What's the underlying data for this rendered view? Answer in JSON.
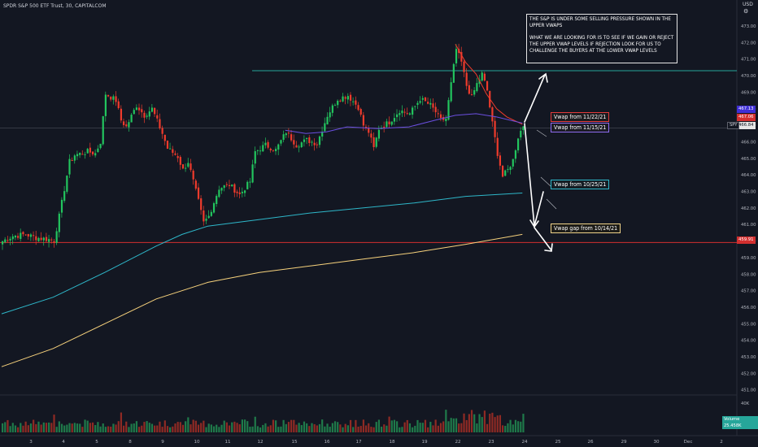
{
  "header": {
    "title": "SPDR S&P 500 ETF Trust, 30, CAPITALCOM",
    "currency": "USD"
  },
  "note": {
    "paragraph1": "THE S&P IS UNDER SOME SELLING PRESSURE SHOWN IN THE UPPER VWAPS",
    "paragraph2": "WHAT WE ARE LOOKING FOR IS TO SEE IF WE GAIN OR REJECT THE UPPER VWAP LEVELS IF REJECTION LOOK FOR US TO CHALLENGE THE BUYERS AT THE LOWER VWAP LEVELS"
  },
  "labels": {
    "vwap_1122": "Vwap from 11/22/21",
    "vwap_1115": "Vwap from 11/15/21",
    "vwap_1025": "Vwap from 10/25/21",
    "vwap_1014": "Vwap gap from 10/14/21",
    "symbol": "SPY",
    "volume": "Volume",
    "volume_value": "25.458K"
  },
  "price_labels": {
    "p1": "467.13",
    "p2": "467.06",
    "last": "466.84",
    "p4": "459.91"
  },
  "colors": {
    "background": "#131722",
    "up": "#22c55e",
    "down": "#ef3b2c",
    "vwap_1122": "#ef3b2c",
    "vwap_1115": "#6b4fe0",
    "vwap_1025": "#2eb7c9",
    "vwap_1014": "#f7d27c",
    "hline_teal": "#26a69a",
    "hline_red": "#d32f2f"
  },
  "chart_data": {
    "type": "candlestick",
    "interval": "30m",
    "y_axis": {
      "ticks": [
        451,
        452,
        453,
        454,
        455,
        456,
        457,
        458,
        459,
        460,
        461,
        462,
        463,
        464,
        465,
        466,
        467,
        468,
        469,
        470,
        471,
        472,
        473
      ],
      "ylim": [
        450.3,
        473.8
      ]
    },
    "x_axis": {
      "ticks": [
        "3",
        "4",
        "5",
        "8",
        "9",
        "10",
        "11",
        "12",
        "15",
        "16",
        "17",
        "18",
        "19",
        "22",
        "23",
        "24",
        "25",
        "26",
        "29",
        "30",
        "Dec",
        "2"
      ]
    },
    "horizontal_lines": [
      {
        "price": 470.3,
        "color": "teal"
      },
      {
        "price": 466.84,
        "color": "gray"
      },
      {
        "price": 459.91,
        "color": "red"
      }
    ],
    "close_path": [
      [
        0,
        460.0
      ],
      [
        4,
        460.3
      ],
      [
        9,
        460.4
      ],
      [
        13,
        460.2
      ],
      [
        18,
        460.1
      ],
      [
        20,
        460.0
      ],
      [
        22,
        461.5
      ],
      [
        26,
        464.8
      ],
      [
        28,
        465.2
      ],
      [
        33,
        465.4
      ],
      [
        36,
        465.3
      ],
      [
        38,
        466.0
      ],
      [
        40,
        468.9
      ],
      [
        44,
        468.5
      ],
      [
        46,
        467.3
      ],
      [
        48,
        466.9
      ],
      [
        52,
        468.2
      ],
      [
        55,
        467.6
      ],
      [
        58,
        468.0
      ],
      [
        62,
        466.5
      ],
      [
        64,
        465.6
      ],
      [
        68,
        465.1
      ],
      [
        70,
        464.3
      ],
      [
        72,
        464.8
      ],
      [
        76,
        462.4
      ],
      [
        78,
        461.1
      ],
      [
        80,
        461.5
      ],
      [
        84,
        463.2
      ],
      [
        88,
        463.4
      ],
      [
        92,
        462.8
      ],
      [
        96,
        463.6
      ],
      [
        98,
        465.4
      ],
      [
        102,
        465.8
      ],
      [
        106,
        465.5
      ],
      [
        110,
        466.6
      ],
      [
        114,
        465.8
      ],
      [
        118,
        466.1
      ],
      [
        122,
        465.9
      ],
      [
        126,
        467.6
      ],
      [
        130,
        468.6
      ],
      [
        134,
        468.8
      ],
      [
        138,
        468.1
      ],
      [
        140,
        467.0
      ],
      [
        142,
        466.6
      ],
      [
        144,
        465.6
      ],
      [
        146,
        466.8
      ],
      [
        150,
        467.2
      ],
      [
        154,
        467.9
      ],
      [
        158,
        467.7
      ],
      [
        162,
        468.6
      ],
      [
        166,
        468.2
      ],
      [
        168,
        467.8
      ],
      [
        170,
        467.3
      ],
      [
        172,
        467.4
      ],
      [
        174,
        469.5
      ],
      [
        176,
        471.6
      ],
      [
        178,
        470.8
      ],
      [
        180,
        469.4
      ],
      [
        182,
        468.7
      ],
      [
        184,
        469.5
      ],
      [
        186,
        470.1
      ],
      [
        188,
        469.1
      ],
      [
        190,
        467.1
      ],
      [
        192,
        465.3
      ],
      [
        194,
        463.9
      ],
      [
        196,
        464.3
      ],
      [
        198,
        464.9
      ],
      [
        200,
        466.3
      ],
      [
        202,
        467.0
      ]
    ],
    "vwap_series": [
      {
        "name": "Vwap from 11/22/21",
        "color": "red",
        "points": [
          [
            176,
            471.9
          ],
          [
            180,
            470.8
          ],
          [
            184,
            470.1
          ],
          [
            188,
            468.9
          ],
          [
            192,
            468.0
          ],
          [
            196,
            467.5
          ],
          [
            202,
            467.06
          ]
        ]
      },
      {
        "name": "Vwap from 11/15/21",
        "color": "purple",
        "points": [
          [
            110,
            466.7
          ],
          [
            118,
            466.5
          ],
          [
            126,
            466.6
          ],
          [
            134,
            466.9
          ],
          [
            146,
            466.8
          ],
          [
            158,
            466.9
          ],
          [
            168,
            467.3
          ],
          [
            176,
            467.6
          ],
          [
            184,
            467.7
          ],
          [
            192,
            467.5
          ],
          [
            202,
            467.13
          ]
        ]
      },
      {
        "name": "Vwap from 10/25/21",
        "color": "teal",
        "points": [
          [
            0,
            455.6
          ],
          [
            20,
            456.6
          ],
          [
            40,
            458.1
          ],
          [
            60,
            459.7
          ],
          [
            70,
            460.4
          ],
          [
            80,
            460.9
          ],
          [
            100,
            461.3
          ],
          [
            120,
            461.7
          ],
          [
            140,
            462.0
          ],
          [
            160,
            462.3
          ],
          [
            180,
            462.7
          ],
          [
            202,
            462.9
          ]
        ]
      },
      {
        "name": "Vwap gap from 10/14/21",
        "color": "yellow",
        "points": [
          [
            0,
            452.4
          ],
          [
            20,
            453.5
          ],
          [
            40,
            455.0
          ],
          [
            60,
            456.5
          ],
          [
            80,
            457.5
          ],
          [
            100,
            458.1
          ],
          [
            120,
            458.5
          ],
          [
            140,
            458.9
          ],
          [
            160,
            459.3
          ],
          [
            180,
            459.8
          ],
          [
            202,
            460.4
          ]
        ]
      }
    ],
    "volume": {
      "label": "Volume",
      "last": "25.458K",
      "axis_label": "40K"
    }
  }
}
